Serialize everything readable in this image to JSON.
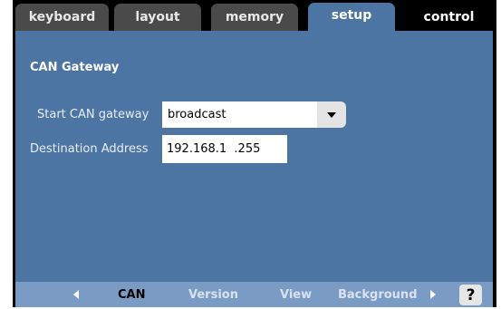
{
  "tabs": [
    {
      "label": "keyboard"
    },
    {
      "label": "layout"
    },
    {
      "label": "memory"
    },
    {
      "label": "setup"
    },
    {
      "label": "control"
    }
  ],
  "active_tab": "setup",
  "section": {
    "title": "CAN Gateway"
  },
  "fields": {
    "start_gateway": {
      "label": "Start CAN gateway",
      "value": "broadcast"
    },
    "destination": {
      "label": "Destination Address",
      "value": "192.168.1  .255"
    }
  },
  "bottom_nav": {
    "items": [
      {
        "label": "CAN"
      },
      {
        "label": "Version"
      },
      {
        "label": "View"
      },
      {
        "label": "Background"
      }
    ],
    "current": "CAN",
    "help_label": "?"
  },
  "icons": {
    "prev": "left-triangle-icon",
    "next": "right-triangle-icon",
    "dropdown": "dropdown-arrow-icon"
  },
  "colors": {
    "panel": "#4d75a3",
    "bottom_bar": "#7a9cc4",
    "tab_inactive": "#4a4a4a",
    "frame": "#000000"
  }
}
